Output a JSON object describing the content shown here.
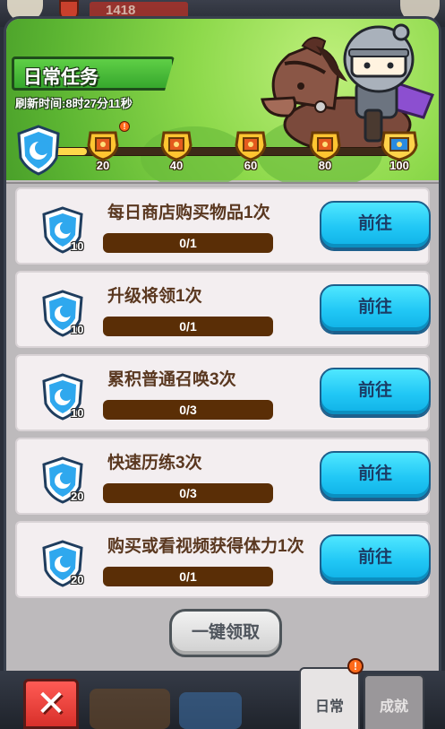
{
  "top_bar": {
    "resource_value": "1418"
  },
  "header": {
    "title": "日常任务",
    "refresh_label": "刷新时间:",
    "refresh_time": "8时27分11秒",
    "progress_fraction": 0.1,
    "milestones": [
      {
        "value": "20",
        "alert": "!"
      },
      {
        "value": "40"
      },
      {
        "value": "60"
      },
      {
        "value": "80"
      },
      {
        "value": "100"
      }
    ]
  },
  "tasks": [
    {
      "title": "每日商店购买物品1次",
      "reward": "10",
      "progress": "0/1",
      "button": "前往"
    },
    {
      "title": "升级将领1次",
      "reward": "10",
      "progress": "0/1",
      "button": "前往"
    },
    {
      "title": "累积普通召唤3次",
      "reward": "10",
      "progress": "0/3",
      "button": "前往"
    },
    {
      "title": "快速历练3次",
      "reward": "20",
      "progress": "0/3",
      "button": "前往"
    },
    {
      "title": "购买或看视频获得体力1次",
      "reward": "20",
      "progress": "0/1",
      "button": "前往"
    }
  ],
  "claim_all": "一键领取",
  "tabs": {
    "daily": "日常",
    "achievement": "成就",
    "alert": "!"
  },
  "close_icon": "close-x-icon",
  "colors": {
    "header_green": "#8dd94b",
    "go_button": "#21c7f5",
    "progress_bar": "#5a2e06",
    "close_red": "#d8302a"
  }
}
